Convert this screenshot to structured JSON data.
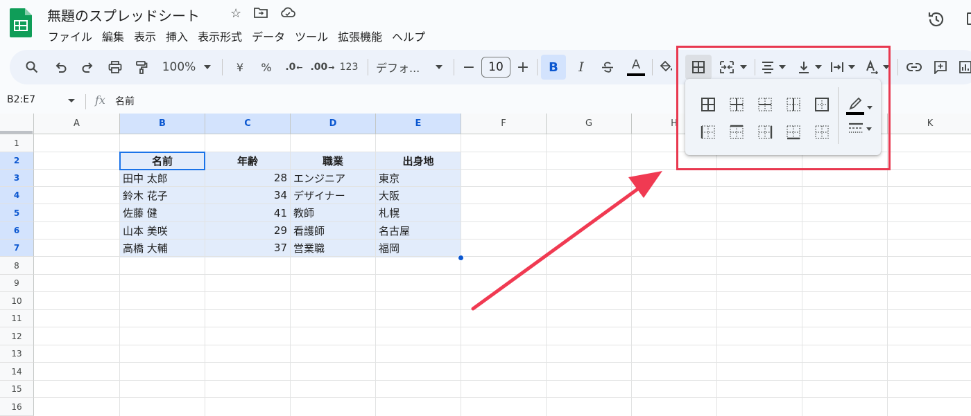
{
  "document": {
    "title": "無題のスプレッドシート"
  },
  "menu": [
    "ファイル",
    "編集",
    "表示",
    "挿入",
    "表示形式",
    "データ",
    "ツール",
    "拡張機能",
    "ヘルプ"
  ],
  "toolbar": {
    "zoom": "100%",
    "currency": "¥",
    "percent": "%",
    "decrease_decimal": ".0",
    "increase_decimal": ".00",
    "number_format": "123",
    "font": "デフォ...",
    "font_size": "10",
    "bold": "B",
    "italic": "I",
    "text_color": "A"
  },
  "formula_bar": {
    "name_box": "B2:E7",
    "fx": "fx",
    "value": "名前"
  },
  "columns": [
    "A",
    "B",
    "C",
    "D",
    "E",
    "F",
    "G",
    "H",
    "I",
    "J",
    "K"
  ],
  "rows": [
    "1",
    "2",
    "3",
    "4",
    "5",
    "6",
    "7",
    "8",
    "9",
    "10",
    "11",
    "12",
    "13",
    "14",
    "15",
    "16"
  ],
  "sheet": {
    "header": [
      "名前",
      "年齢",
      "職業",
      "出身地"
    ],
    "data": [
      [
        "田中 太郎",
        "28",
        "エンジニア",
        "東京"
      ],
      [
        "鈴木 花子",
        "34",
        "デザイナー",
        "大阪"
      ],
      [
        "佐藤 健",
        "41",
        "教師",
        "札幌"
      ],
      [
        "山本 美咲",
        "29",
        "看護師",
        "名古屋"
      ],
      [
        "高橋 大輔",
        "37",
        "営業職",
        "福岡"
      ]
    ]
  },
  "colors": {
    "accent": "#0b57d0",
    "selection": "#d3e3fd",
    "highlight": "#e8384f",
    "logo": "#0f9d58"
  }
}
